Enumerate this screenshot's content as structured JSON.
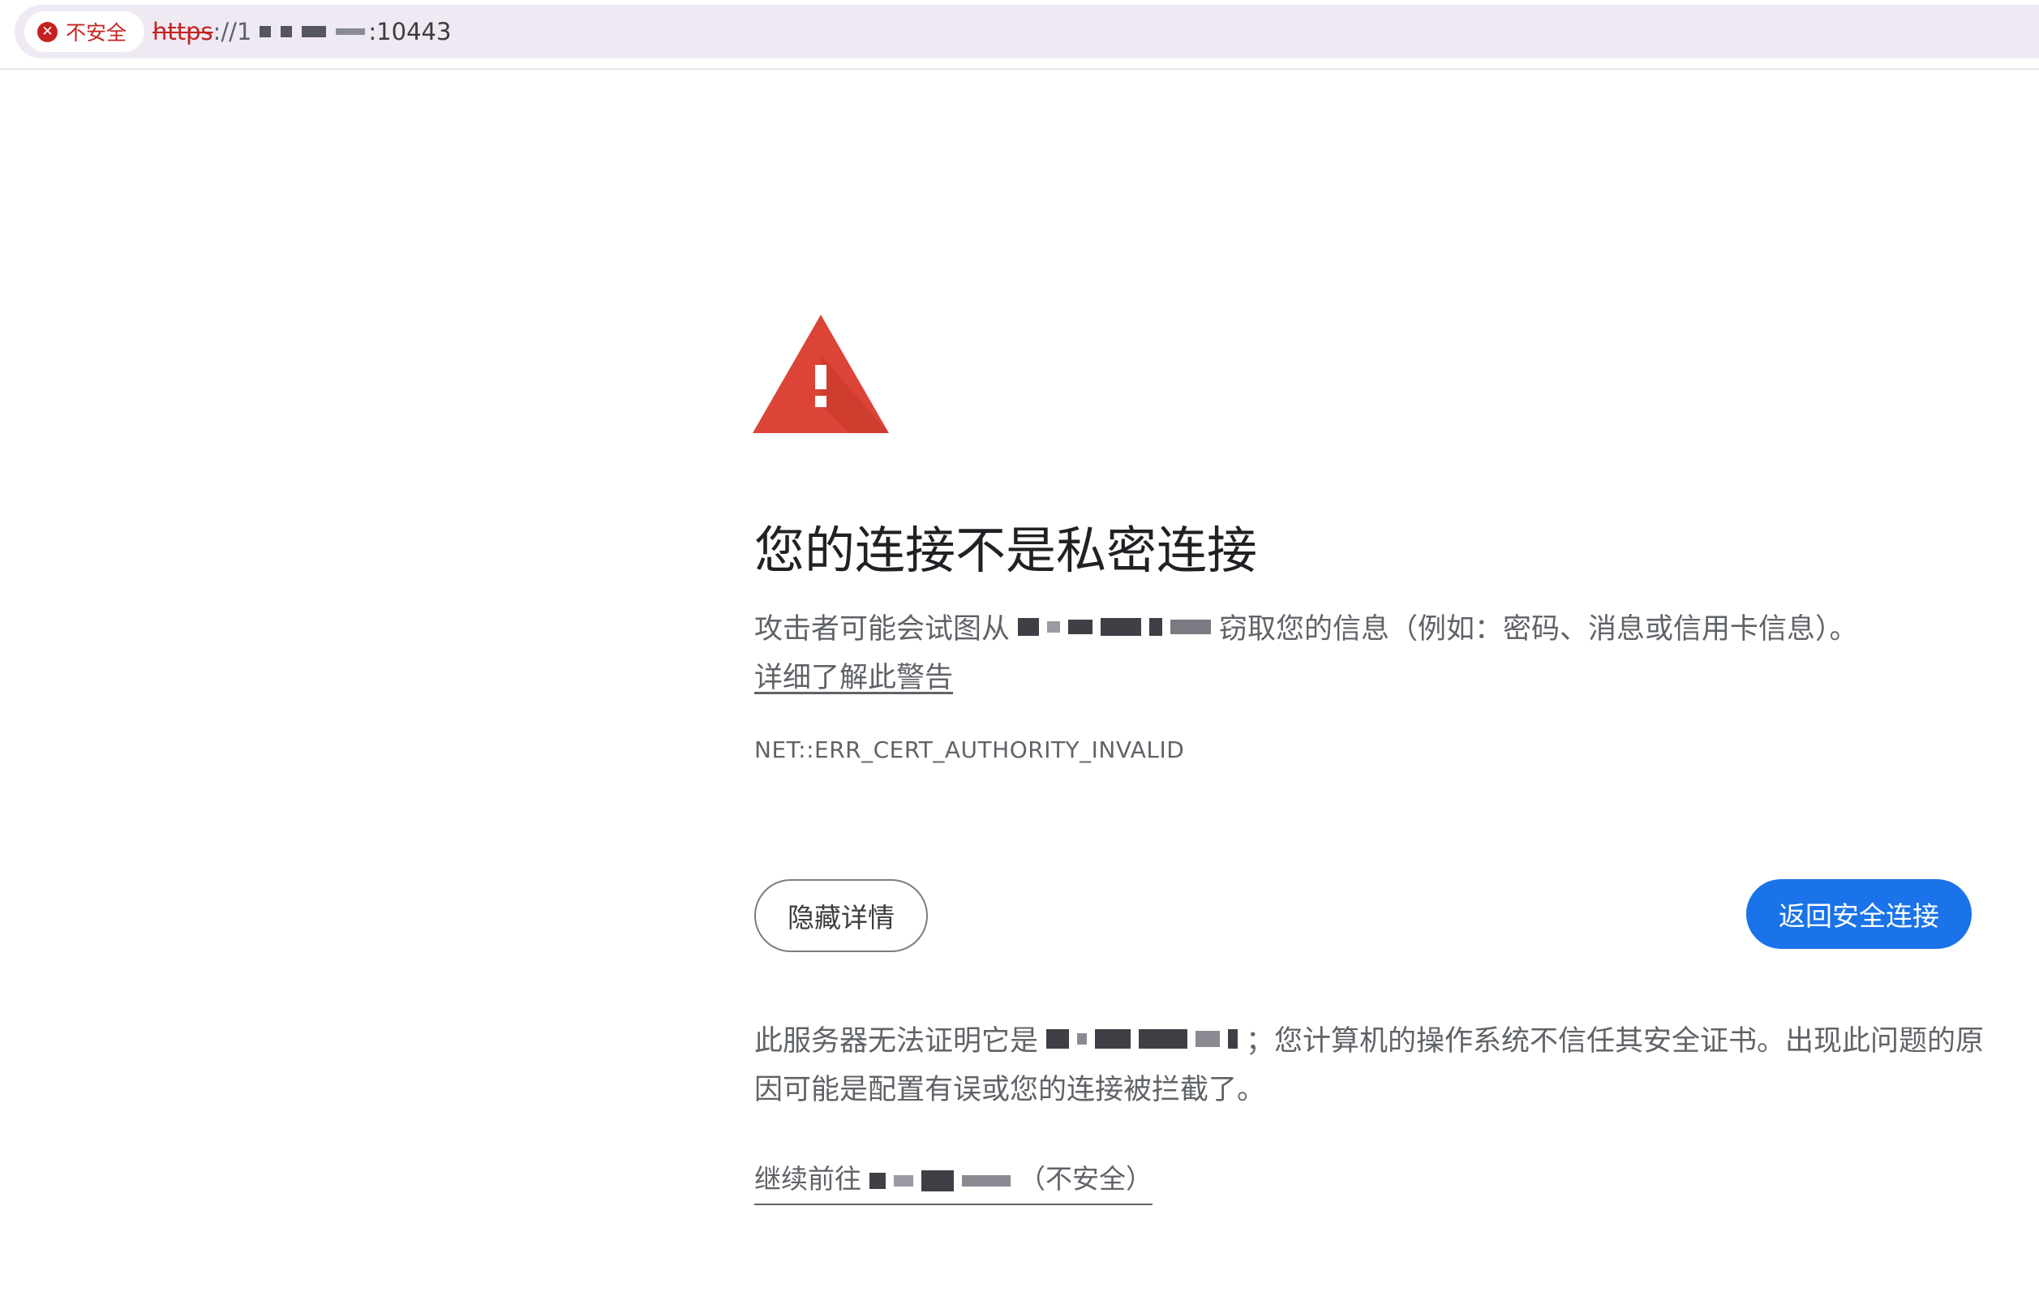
{
  "address_bar": {
    "security_label": "不安全",
    "url_scheme": "https",
    "url_separator": "://1",
    "url_port": ":10443",
    "security_icon": "close-circle-icon"
  },
  "interstitial": {
    "warning_icon": "warning-triangle-icon",
    "heading": "您的连接不是私密连接",
    "attack_text_before": "攻击者可能会试图从",
    "attack_text_after": "窃取您的信息（例如：密码、消息或信用卡信息）。",
    "learn_more": "详细了解此警告",
    "error_code": "NET::ERR_CERT_AUTHORITY_INVALID",
    "hide_details_button": "隐藏详情",
    "back_to_safety_button": "返回安全连接",
    "details_text_before": "此服务器无法证明它是",
    "details_text_after": "；您计算机的操作系统不信任其安全证书。出现此问题的原因可能是配置有误或您的连接被拦截了。",
    "proceed_prefix": "继续前往",
    "proceed_suffix": "（不安全）"
  },
  "colors": {
    "warning_red": "#db4437",
    "button_blue": "#1a73e8",
    "insecure_red": "#c5221f"
  }
}
